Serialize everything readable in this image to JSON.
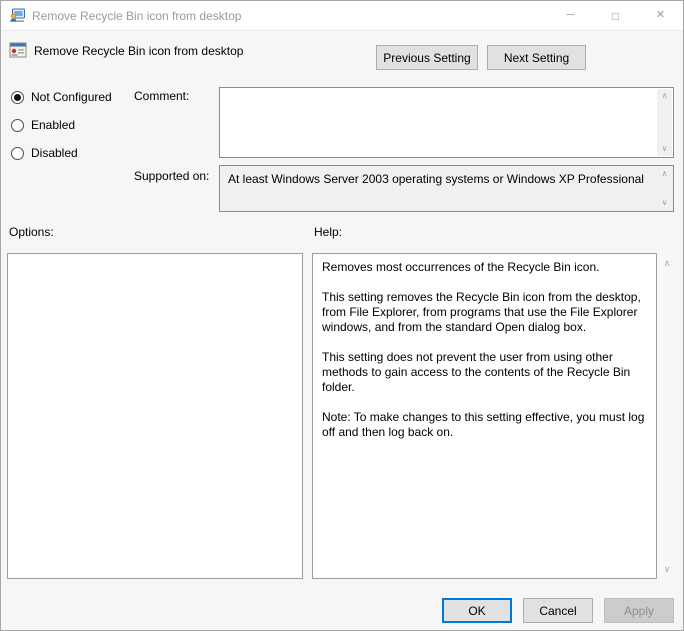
{
  "colors": {
    "accent": "#0078d7",
    "button_bg": "#e1e1e1",
    "button_border": "#adadad",
    "disabled_button_bg": "#cccccc",
    "disabled_text": "#8d8d8d",
    "readonly_bg": "#f0f0f0",
    "inactive_title_text": "#9a9a9a"
  },
  "window": {
    "title": "Remove Recycle Bin icon from desktop"
  },
  "icons": {
    "minimize": "─",
    "maximize": "□",
    "close": "✕",
    "scroll_up": "∧",
    "scroll_down": "∨"
  },
  "header": {
    "policy_name": "Remove Recycle Bin icon from desktop",
    "previous_button": "Previous Setting",
    "next_button": "Next Setting"
  },
  "state_options": {
    "radios": [
      {
        "label": "Not Configured",
        "selected": true
      },
      {
        "label": "Enabled",
        "selected": false
      },
      {
        "label": "Disabled",
        "selected": false
      }
    ]
  },
  "comment": {
    "label": "Comment:",
    "value": ""
  },
  "supported": {
    "label": "Supported on:",
    "value": "At least Windows Server 2003 operating systems or Windows XP Professional"
  },
  "options_panel": {
    "label": "Options:"
  },
  "help_panel": {
    "label": "Help:",
    "paragraphs": [
      "Removes most occurrences of the Recycle Bin icon.",
      "This setting removes the Recycle Bin icon from the desktop, from File Explorer, from programs that use the File Explorer windows, and from the standard Open dialog box.",
      "This setting does not prevent the user from using other methods to gain access to the contents of the Recycle Bin folder.",
      "Note: To make changes to this setting effective, you must log off and then log back on."
    ]
  },
  "footer": {
    "ok": "OK",
    "cancel": "Cancel",
    "apply": "Apply"
  }
}
